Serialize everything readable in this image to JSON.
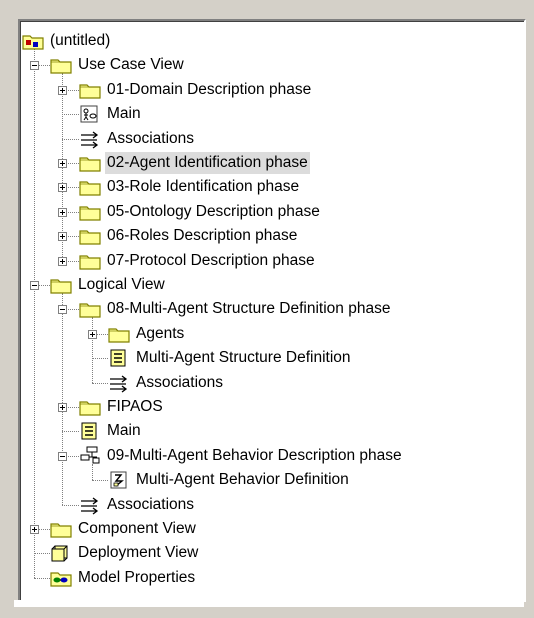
{
  "tree": {
    "nodes": [
      {
        "key": "root",
        "label": "(untitled)",
        "icon": "model-root-icon",
        "depth": 0,
        "expander": null,
        "selected": false
      },
      {
        "key": "use-case-view",
        "label": "Use Case View",
        "icon": "folder-icon",
        "depth": 1,
        "expander": "minus",
        "selected": false
      },
      {
        "key": "domain-description",
        "label": "01-Domain Description phase",
        "icon": "folder-icon",
        "depth": 2,
        "expander": "plus",
        "selected": false
      },
      {
        "key": "uc-main",
        "label": "Main",
        "icon": "use-case-diagram-icon",
        "depth": 2,
        "expander": null,
        "selected": false
      },
      {
        "key": "uc-associations",
        "label": "Associations",
        "icon": "associations-icon",
        "depth": 2,
        "expander": null,
        "selected": false
      },
      {
        "key": "agent-identification",
        "label": "02-Agent Identification phase",
        "icon": "folder-icon",
        "depth": 2,
        "expander": "plus",
        "selected": true
      },
      {
        "key": "role-identification",
        "label": "03-Role Identification phase",
        "icon": "folder-icon",
        "depth": 2,
        "expander": "plus",
        "selected": false
      },
      {
        "key": "ontology-description",
        "label": "05-Ontology Description phase",
        "icon": "folder-icon",
        "depth": 2,
        "expander": "plus",
        "selected": false
      },
      {
        "key": "roles-description",
        "label": "06-Roles Description phase",
        "icon": "folder-icon",
        "depth": 2,
        "expander": "plus",
        "selected": false
      },
      {
        "key": "protocol-description",
        "label": "07-Protocol Description phase",
        "icon": "folder-icon",
        "depth": 2,
        "expander": "plus",
        "selected": false
      },
      {
        "key": "logical-view",
        "label": "Logical View",
        "icon": "folder-icon",
        "depth": 1,
        "expander": "minus",
        "selected": false
      },
      {
        "key": "mas-definition-phase",
        "label": "08-Multi-Agent Structure Definition phase",
        "icon": "folder-icon",
        "depth": 2,
        "expander": "minus",
        "selected": false
      },
      {
        "key": "agents",
        "label": "Agents",
        "icon": "folder-icon",
        "depth": 3,
        "expander": "plus",
        "selected": false
      },
      {
        "key": "mas-definition",
        "label": "Multi-Agent Structure Definition",
        "icon": "class-diagram-icon",
        "depth": 3,
        "expander": null,
        "selected": false
      },
      {
        "key": "mas-associations",
        "label": "Associations",
        "icon": "associations-icon",
        "depth": 3,
        "expander": null,
        "selected": false
      },
      {
        "key": "fipaos",
        "label": "FIPAOS",
        "icon": "folder-icon",
        "depth": 2,
        "expander": "plus",
        "selected": false
      },
      {
        "key": "lv-main",
        "label": "Main",
        "icon": "class-diagram-icon",
        "depth": 2,
        "expander": null,
        "selected": false
      },
      {
        "key": "mab-description-phase",
        "label": "09-Multi-Agent Behavior Description phase",
        "icon": "package-icon",
        "depth": 2,
        "expander": "minus",
        "selected": false
      },
      {
        "key": "mab-definition",
        "label": "Multi-Agent Behavior Definition",
        "icon": "activity-diagram-icon",
        "depth": 3,
        "expander": null,
        "selected": false
      },
      {
        "key": "lv-associations",
        "label": "Associations",
        "icon": "associations-icon",
        "depth": 2,
        "expander": null,
        "selected": false
      },
      {
        "key": "component-view",
        "label": "Component View",
        "icon": "folder-icon",
        "depth": 1,
        "expander": "plus",
        "selected": false
      },
      {
        "key": "deployment-view",
        "label": "Deployment View",
        "icon": "deployment-icon",
        "depth": 1,
        "expander": null,
        "selected": false
      },
      {
        "key": "model-properties",
        "label": "Model Properties",
        "icon": "model-properties-icon",
        "depth": 1,
        "expander": null,
        "selected": false
      }
    ]
  },
  "colors": {
    "folder": "#ffff99",
    "folder_outline": "#808000",
    "selection": "#dcdcdc"
  }
}
